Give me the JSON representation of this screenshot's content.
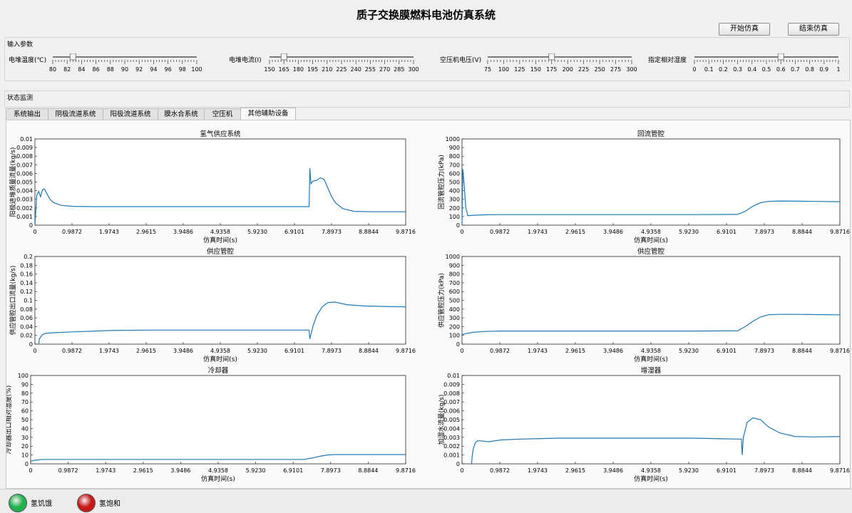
{
  "app": {
    "title": "质子交换膜燃料电池仿真系统"
  },
  "buttons": {
    "start": "开始仿真",
    "end": "结束仿真"
  },
  "input_panel": {
    "title": "输入参数",
    "sliders": [
      {
        "label": "电堆温度(℃)",
        "ticks": [
          "80",
          "82",
          "84",
          "86",
          "88",
          "90",
          "92",
          "94",
          "96",
          "98",
          "100"
        ],
        "min": 80,
        "max": 100,
        "value": 82.8
      },
      {
        "label": "电堆电流(I)",
        "ticks": [
          "150",
          "165",
          "180",
          "195",
          "210",
          "225",
          "240",
          "255",
          "270",
          "285",
          "300"
        ],
        "min": 150,
        "max": 300,
        "value": 165
      },
      {
        "label": "空压机电压(V)",
        "ticks": [
          "75",
          "100",
          "125",
          "150",
          "175",
          "200",
          "225",
          "250",
          "275",
          "300"
        ],
        "min": 75,
        "max": 300,
        "value": 175
      },
      {
        "label": "指定相对湿度",
        "ticks": [
          "0",
          "0.1",
          "0.2",
          "0.3",
          "0.4",
          "0.5",
          "0.6",
          "0.7",
          "0.8",
          "0.9",
          "1"
        ],
        "min": 0,
        "max": 1,
        "value": 0.6
      }
    ]
  },
  "status_panel": {
    "title": "状态监测"
  },
  "tabs": [
    {
      "label": "系统输出",
      "active": false
    },
    {
      "label": "阴极流道系统",
      "active": false
    },
    {
      "label": "阳极流道系统",
      "active": false
    },
    {
      "label": "膜水合系统",
      "active": false
    },
    {
      "label": "空压机",
      "active": false
    },
    {
      "label": "其他辅助设备",
      "active": true
    }
  ],
  "chart_data": [
    {
      "type": "line",
      "title": "氢气供应系统",
      "xlabel": "仿真时间(s)",
      "ylabel": "阳极进堆质量流量(kg/s)",
      "xticks": [
        "0",
        "0.9872",
        "1.9743",
        "2.9615",
        "3.9486",
        "4.9358",
        "5.9230",
        "6.9101",
        "7.8973",
        "8.8844",
        "9.8716"
      ],
      "yticks": [
        "0",
        "0.001",
        "0.002",
        "0.003",
        "0.004",
        "0.005",
        "0.006",
        "0.007",
        "0.008",
        "0.009",
        "0.01"
      ],
      "xlim": [
        0,
        9.8716
      ],
      "ylim": [
        0,
        0.01
      ],
      "x": [
        0,
        0.05,
        0.1,
        0.15,
        0.2,
        0.25,
        0.3,
        0.4,
        0.5,
        0.7,
        1.0,
        1.5,
        2.5,
        4,
        6,
        7.3,
        7.32,
        7.35,
        7.4,
        7.5,
        7.6,
        7.7,
        7.8,
        7.9,
        8.0,
        8.2,
        8.5,
        9.0,
        9.5,
        9.8716
      ],
      "y": [
        0,
        0.0035,
        0.0039,
        0.0033,
        0.0041,
        0.0042,
        0.0038,
        0.003,
        0.0026,
        0.0023,
        0.00218,
        0.00215,
        0.00215,
        0.00215,
        0.00215,
        0.00215,
        0.0066,
        0.0048,
        0.0051,
        0.0052,
        0.0055,
        0.0053,
        0.0043,
        0.0033,
        0.0026,
        0.0019,
        0.0016,
        0.00155,
        0.00155,
        0.00155
      ]
    },
    {
      "type": "line",
      "title": "回流管腔",
      "xlabel": "仿真时间(s)",
      "ylabel": "回流管腔压力(kPa)",
      "xticks": [
        "0",
        "0.9872",
        "1.9743",
        "2.9615",
        "3.9486",
        "4.9358",
        "5.9230",
        "6.9101",
        "7.8973",
        "8.8844",
        "9.8716"
      ],
      "yticks": [
        "0",
        "100",
        "200",
        "300",
        "400",
        "500",
        "600",
        "700",
        "800",
        "900",
        "1000"
      ],
      "xlim": [
        0,
        9.8716
      ],
      "ylim": [
        0,
        1000
      ],
      "x": [
        0,
        0.02,
        0.05,
        0.1,
        0.15,
        0.3,
        0.6,
        1,
        2,
        4,
        6,
        7.2,
        7.4,
        7.6,
        7.8,
        8.0,
        8.3,
        8.8,
        9.3,
        9.8716
      ],
      "y": [
        0,
        650,
        500,
        200,
        110,
        115,
        120,
        122,
        122,
        122,
        122,
        125,
        160,
        220,
        260,
        275,
        280,
        278,
        275,
        272
      ]
    },
    {
      "type": "line",
      "title": "供应管腔",
      "xlabel": "仿真时间(s)",
      "ylabel": "供应管腔出口流量(kg/s)",
      "xticks": [
        "0",
        "0.9872",
        "1.9743",
        "2.9615",
        "3.9486",
        "4.9358",
        "5.9230",
        "6.9101",
        "7.8973",
        "8.8844",
        "9.8716"
      ],
      "yticks": [
        "0",
        "0.02",
        "0.04",
        "0.06",
        "0.08",
        "0.1",
        "0.12",
        "0.14",
        "0.16",
        "0.18",
        "0.2"
      ],
      "xlim": [
        0,
        9.8716
      ],
      "ylim": [
        0,
        0.2
      ],
      "x": [
        0.1,
        0.12,
        0.2,
        0.3,
        0.5,
        1,
        2,
        3,
        5,
        7.3,
        7.32,
        7.4,
        7.5,
        7.65,
        7.8,
        8.0,
        8.3,
        8.8,
        9.3,
        9.8716
      ],
      "y": [
        0,
        0.012,
        0.022,
        0.025,
        0.026,
        0.028,
        0.031,
        0.032,
        0.032,
        0.032,
        0.012,
        0.04,
        0.065,
        0.085,
        0.095,
        0.096,
        0.09,
        0.087,
        0.086,
        0.085
      ]
    },
    {
      "type": "line",
      "title": "供应管腔",
      "xlabel": "仿真时间(s)",
      "ylabel": "供应管腔压力(kPa)",
      "xticks": [
        "0",
        "0.9872",
        "1.9743",
        "2.9615",
        "3.9486",
        "4.9358",
        "5.9230",
        "6.9101",
        "7.8973",
        "8.8844",
        "9.8716"
      ],
      "yticks": [
        "0",
        "100",
        "200",
        "300",
        "400",
        "500",
        "600",
        "700",
        "800",
        "900",
        "1000"
      ],
      "xlim": [
        0,
        9.8716
      ],
      "ylim": [
        0,
        1000
      ],
      "x": [
        0,
        0.1,
        0.3,
        0.6,
        1,
        2,
        4,
        6,
        7.2,
        7.4,
        7.6,
        7.8,
        8.0,
        8.3,
        8.8,
        9.3,
        9.8716
      ],
      "y": [
        110,
        120,
        135,
        145,
        150,
        150,
        150,
        150,
        152,
        200,
        260,
        310,
        335,
        340,
        340,
        337,
        335
      ]
    },
    {
      "type": "line",
      "title": "冷却器",
      "xlabel": "仿真时间(s)",
      "ylabel": "冷却器出口相对湿度(%)",
      "xticks": [
        "0",
        "0.9872",
        "1.9743",
        "2.9615",
        "3.9486",
        "4.9358",
        "5.9230",
        "6.9101",
        "7.8973",
        "8.8844",
        "9.8716"
      ],
      "yticks": [
        "0",
        "10",
        "20",
        "30",
        "40",
        "50",
        "60",
        "70",
        "80",
        "90",
        "100"
      ],
      "xlim": [
        0,
        9.8716
      ],
      "ylim": [
        0,
        100
      ],
      "x": [
        0,
        0.1,
        0.3,
        0.6,
        1,
        2,
        4,
        6,
        7.2,
        7.4,
        7.6,
        7.8,
        8.0,
        8.4,
        9.0,
        9.8716
      ],
      "y": [
        3,
        4,
        5,
        5,
        5,
        5,
        5,
        5,
        5,
        6.5,
        8.5,
        10,
        10.5,
        10.5,
        10.5,
        10.5
      ]
    },
    {
      "type": "line",
      "title": "增湿器",
      "xlabel": "仿真时间(s)",
      "ylabel": "加湿水流量(kg/s)",
      "xticks": [
        "0",
        "0.9872",
        "1.9743",
        "2.9615",
        "3.9486",
        "4.9358",
        "5.9230",
        "6.9101",
        "7.8973",
        "8.8844",
        "9.8716"
      ],
      "yticks": [
        "0",
        "0.001",
        "0.002",
        "0.003",
        "0.004",
        "0.005",
        "0.006",
        "0.007",
        "0.008",
        "0.009",
        "0.01"
      ],
      "xlim": [
        0,
        9.8716
      ],
      "ylim": [
        0,
        0.01
      ],
      "x": [
        0.25,
        0.27,
        0.3,
        0.35,
        0.4,
        0.5,
        0.7,
        1,
        1.5,
        2.5,
        4,
        6,
        7.3,
        7.32,
        7.35,
        7.45,
        7.6,
        7.8,
        8.0,
        8.3,
        8.7,
        9.2,
        9.8716
      ],
      "y": [
        0,
        0.001,
        0.0018,
        0.0024,
        0.0026,
        0.0026,
        0.0025,
        0.0027,
        0.0028,
        0.0029,
        0.0029,
        0.0029,
        0.0028,
        0.001,
        0.003,
        0.0047,
        0.0052,
        0.005,
        0.0042,
        0.0035,
        0.0031,
        0.00305,
        0.0031
      ]
    }
  ],
  "indicators": [
    {
      "label": "氢饥饿",
      "color": "#22b14c"
    },
    {
      "label": "氢饱和",
      "color": "#c81818"
    }
  ],
  "colors": {
    "line": "#1f77b4"
  }
}
